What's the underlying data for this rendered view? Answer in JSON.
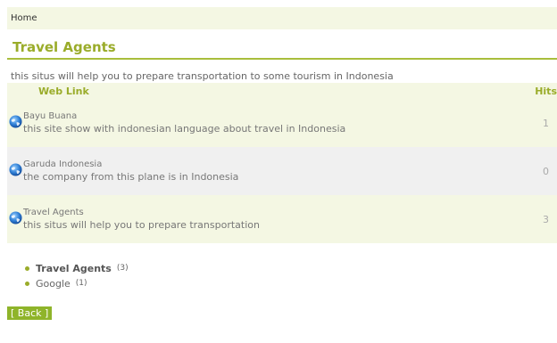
{
  "breadcrumb": {
    "home": "Home"
  },
  "page": {
    "title": "Travel Agents",
    "description": "this situs will help you to prepare transportation to some tourism in Indonesia"
  },
  "table": {
    "col_link": "Web Link",
    "col_hits": "Hits",
    "rows": [
      {
        "name": "Bayu Buana",
        "description": "this site show with indonesian language about travel in Indonesia",
        "hits": "1"
      },
      {
        "name": "Garuda Indonesia",
        "description": "the company from this plane is in Indonesia",
        "hits": "0"
      },
      {
        "name": "Travel Agents",
        "description": "this situs will help you to prepare transportation",
        "hits": "3"
      }
    ]
  },
  "categories": [
    {
      "name": "Travel Agents",
      "count": "(3)",
      "active": true
    },
    {
      "name": "Google",
      "count": "(1)",
      "active": false
    }
  ],
  "back_label": "[ Back ]",
  "icons": {
    "link": "globe-icon",
    "bullet": "bullet-icon"
  },
  "colors": {
    "accent": "#9aac2a",
    "row_light": "#f4f7e3",
    "row_grey": "#f0f0f0",
    "button": "#8fb42a"
  }
}
